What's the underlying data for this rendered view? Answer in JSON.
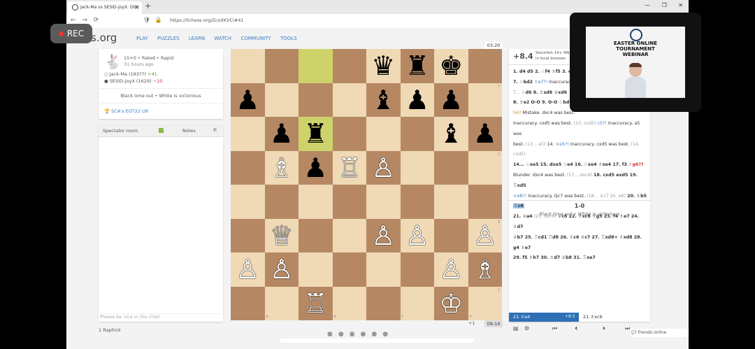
{
  "recording": {
    "label": "REC"
  },
  "browser": {
    "tab_title": "Jack-Ma vs SESID-JoyX: D00 C...",
    "url": "https://lichess.org/ZcoXKVCi#41",
    "window_controls": "— ❐ ✕"
  },
  "site": {
    "logo": "lichess.org",
    "logo_visible": "ess.org",
    "menu": [
      "PLAY",
      "PUZZLES",
      "LEARN",
      "WATCH",
      "COMMUNITY",
      "TOOLS"
    ]
  },
  "game": {
    "mode": "15+0 • Rated • Rapid",
    "time_ago": "31 hours ago",
    "white": {
      "name": "Jack-Ma (1837?)",
      "diff": "+41"
    },
    "black": {
      "name": "SESID-JoyX (1629)",
      "diff": "−10"
    },
    "result_text": "Black time out • White is victorious",
    "tournament": "SCA's EOT22 U9"
  },
  "chat": {
    "tab_room": "Spectator room",
    "tab_notes": "Notes",
    "placeholder": "Please be nice in the chat!"
  },
  "clocks": {
    "top": "03:20",
    "bottom": "09:14"
  },
  "board": {
    "files": [
      "a",
      "b",
      "c",
      "d",
      "e",
      "f",
      "g",
      "h"
    ],
    "ranks": [
      "8",
      "7",
      "6",
      "5",
      "4",
      "3",
      "2",
      "1"
    ],
    "highlight": [
      "c8",
      "c6"
    ],
    "pieces": [
      {
        "sq": "e8",
        "p": "♛",
        "c": "b"
      },
      {
        "sq": "f8",
        "p": "♜",
        "c": "b"
      },
      {
        "sq": "g8",
        "p": "♚",
        "c": "b"
      },
      {
        "sq": "a7",
        "p": "♟",
        "c": "b"
      },
      {
        "sq": "e7",
        "p": "♝",
        "c": "b"
      },
      {
        "sq": "f7",
        "p": "♟",
        "c": "b"
      },
      {
        "sq": "g7",
        "p": "♟",
        "c": "b"
      },
      {
        "sq": "b6",
        "p": "♟",
        "c": "b"
      },
      {
        "sq": "c6",
        "p": "♜",
        "c": "b"
      },
      {
        "sq": "g6",
        "p": "♝",
        "c": "b"
      },
      {
        "sq": "h6",
        "p": "♟",
        "c": "b"
      },
      {
        "sq": "b5",
        "p": "♗",
        "c": "w"
      },
      {
        "sq": "c5",
        "p": "♟",
        "c": "b"
      },
      {
        "sq": "d5",
        "p": "♖",
        "c": "w"
      },
      {
        "sq": "e5",
        "p": "♙",
        "c": "w"
      },
      {
        "sq": "b3",
        "p": "♕",
        "c": "w"
      },
      {
        "sq": "e3",
        "p": "♙",
        "c": "w"
      },
      {
        "sq": "f3",
        "p": "♙",
        "c": "w"
      },
      {
        "sq": "h3",
        "p": "♙",
        "c": "w"
      },
      {
        "sq": "a2",
        "p": "♙",
        "c": "w"
      },
      {
        "sq": "b2",
        "p": "♙",
        "c": "w"
      },
      {
        "sq": "g2",
        "p": "♙",
        "c": "w"
      },
      {
        "sq": "h2",
        "p": "♗",
        "c": "w"
      },
      {
        "sq": "c1",
        "p": "♖",
        "c": "w"
      },
      {
        "sq": "g1",
        "p": "♔",
        "c": "w"
      }
    ]
  },
  "analysis": {
    "eval": "+8.4",
    "engine": "Stockfish 14+ NN",
    "engine_sub": "in local browser",
    "result_score": "1-0",
    "result_text": "Black time out • White is victorious",
    "nav_left_move": "21.♕a4",
    "nav_left_eval": "+8.5",
    "nav_right_move": "21.♗xc6"
  },
  "moves_html_lines": [
    "1. d4 d5 2. ♘f4 ♗f5 3. e3 ...",
    "7. ♘bd2 ♗e7?! Inaccuracy ...",
    "7... ♘d6 8. ♗xd6 ♕xd6 ...",
    "8. ♗e2 O-O 9. O-O ♘bd7 ...",
    "h6? Mistake. dxc4 was best ...",
    "Inaccuracy. cxd5 was best. (13. cxd5) c5?! Inaccuracy. a5 was",
    "best. (13... a5) 14. ♕e5?! Inaccuracy. cxd5 was best. (14. cxd5)",
    "14... ♘xe5 15. dxe5 ♘e4 16. ♘xe4 ♗xe4 17. f3 ♗g6??",
    "Blunder. dxc4 was best. (17... dxc4) 18. cxd5 exd5 19. ♖xd5",
    "♕e8?! Inaccuracy. Qc7 was best. (18... ♕c7 20. e6) 20. ♗b5 ♖c6",
    "21. ♕a4 (21. dxc6) ♕c8 22. ♗xc6 ♗g5 23. f4 ♗e7 24. ♗d7",
    "♕b7 25. ♖cd1 ♖d8 26. ♗c6 ♕c7 27. ♖xd8+ ♗xd8 28. g4 ♗e7",
    "29. f5 ♗h7 30. ♗d7 ♕b8 31. ♖xe7"
  ],
  "misc": {
    "spectators": "1  Raphick",
    "watchers": "+1",
    "friends": "friends online"
  },
  "webinar": {
    "title_line1": "EASTER ONLINE",
    "title_line2": "TOURNAMENT",
    "title_line3": "WEBINAR"
  }
}
